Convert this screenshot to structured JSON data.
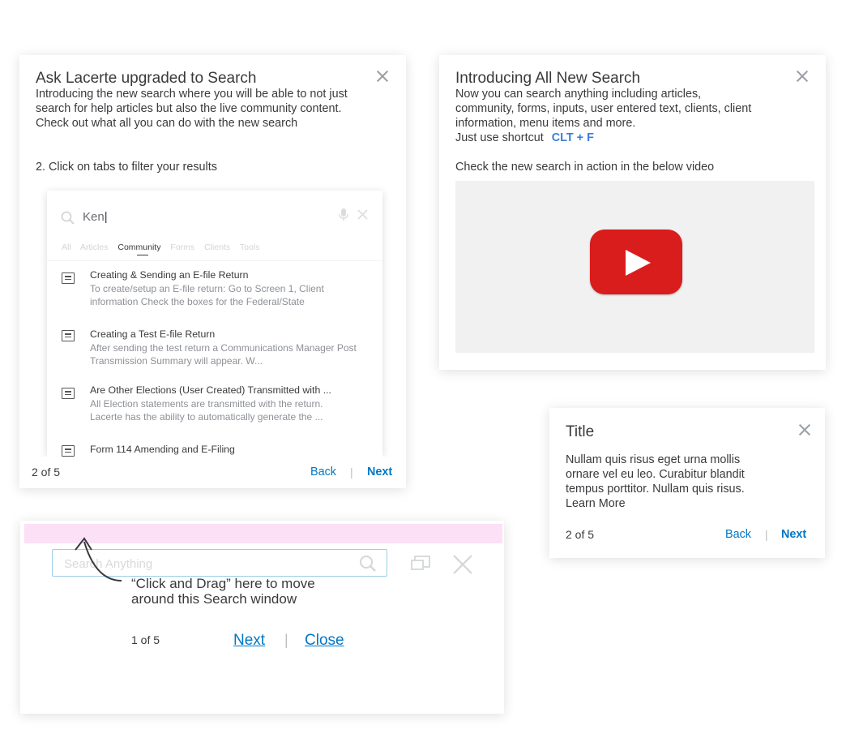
{
  "card1": {
    "title": "Ask Lacerte upgraded to Search",
    "intro": "Introducing the new search where you will be able to not just search for help articles but also the live community content. Check out what all you can do with the new search",
    "step": "2. Click on tabs to filter your results",
    "page": "2 of 5",
    "back": "Back",
    "separator": "|",
    "next": "Next",
    "mock_search": {
      "query": "Ken",
      "tabs": [
        "All",
        "Articles",
        "Community",
        "Forms",
        "Clients",
        "Tools"
      ],
      "active_tab": "Community",
      "results": [
        {
          "title": "Creating & Sending an E-file Return",
          "desc": "To create/setup an E-file return: Go to Screen 1, Client information Check the boxes for the Federal/State"
        },
        {
          "title": "Creating a Test E-file Return",
          "desc": "After sending the test return a Communications Manager Post Transmission Summary will appear. W..."
        },
        {
          "title": "Are Other Elections (User Created) Transmitted with ...",
          "desc": "All Election statements are transmitted with the return. Lacerte has the ability to automatically generate the ..."
        },
        {
          "title": "Form 114 Amending and E-Filing",
          "desc": ""
        }
      ]
    }
  },
  "card2": {
    "title": "Introducing All New Search",
    "intro": "Now you can search anything including articles, community, forms, inputs, user entered text, clients, client information, menu items and more.",
    "shortcut_prefix": "Just use shortcut",
    "shortcut": "CLT + F",
    "video_caption": "Check the new search in action in the below video"
  },
  "card3": {
    "title": "Title",
    "body": "Nullam quis risus eget urna mollis ornare vel eu leo. Curabitur blandit tempus porttitor. Nullam quis risus.",
    "learn_more": "Learn More",
    "page": "2 of 5",
    "back": "Back",
    "separator": "|",
    "next": "Next"
  },
  "card4": {
    "search_placeholder": "Search Anything",
    "hint": "“Click and Drag” here to move around this Search window",
    "page": "1 of 5",
    "next": "Next",
    "separator": "|",
    "close": "Close"
  },
  "colors": {
    "link": "#0077c5",
    "shortcut": "#3b7ddd",
    "drag_bar": "#fbe0f6",
    "youtube_red": "#d91c1c"
  }
}
